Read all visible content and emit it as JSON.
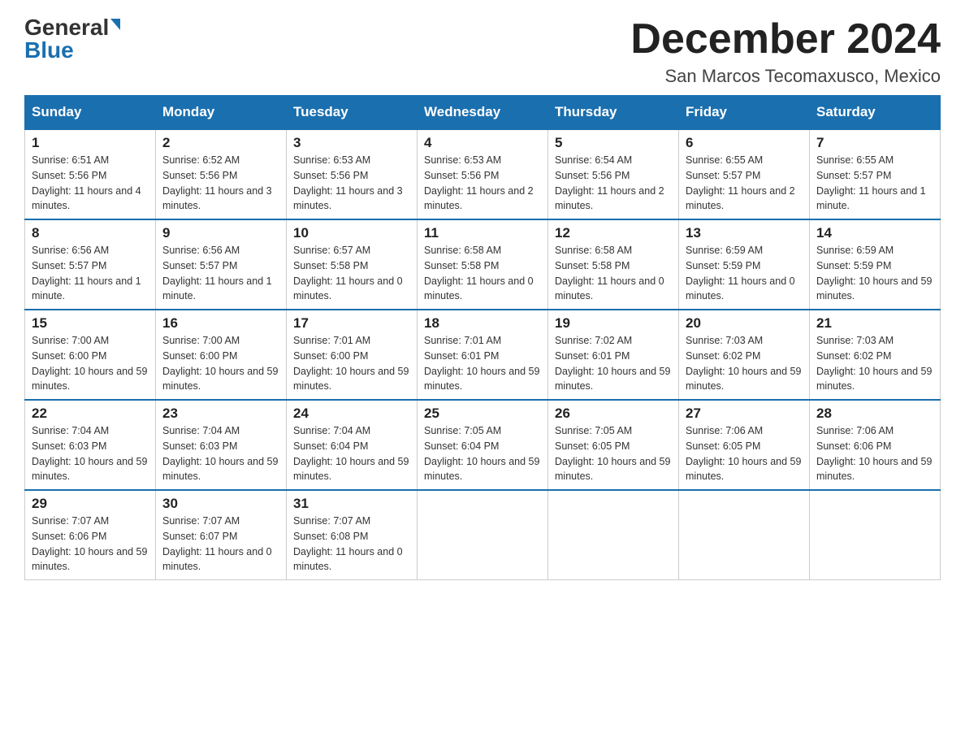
{
  "header": {
    "logo_general": "General",
    "logo_blue": "Blue",
    "title": "December 2024",
    "subtitle": "San Marcos Tecomaxusco, Mexico"
  },
  "days_of_week": [
    "Sunday",
    "Monday",
    "Tuesday",
    "Wednesday",
    "Thursday",
    "Friday",
    "Saturday"
  ],
  "weeks": [
    [
      {
        "day": "1",
        "sunrise": "6:51 AM",
        "sunset": "5:56 PM",
        "daylight": "11 hours and 4 minutes."
      },
      {
        "day": "2",
        "sunrise": "6:52 AM",
        "sunset": "5:56 PM",
        "daylight": "11 hours and 3 minutes."
      },
      {
        "day": "3",
        "sunrise": "6:53 AM",
        "sunset": "5:56 PM",
        "daylight": "11 hours and 3 minutes."
      },
      {
        "day": "4",
        "sunrise": "6:53 AM",
        "sunset": "5:56 PM",
        "daylight": "11 hours and 2 minutes."
      },
      {
        "day": "5",
        "sunrise": "6:54 AM",
        "sunset": "5:56 PM",
        "daylight": "11 hours and 2 minutes."
      },
      {
        "day": "6",
        "sunrise": "6:55 AM",
        "sunset": "5:57 PM",
        "daylight": "11 hours and 2 minutes."
      },
      {
        "day": "7",
        "sunrise": "6:55 AM",
        "sunset": "5:57 PM",
        "daylight": "11 hours and 1 minute."
      }
    ],
    [
      {
        "day": "8",
        "sunrise": "6:56 AM",
        "sunset": "5:57 PM",
        "daylight": "11 hours and 1 minute."
      },
      {
        "day": "9",
        "sunrise": "6:56 AM",
        "sunset": "5:57 PM",
        "daylight": "11 hours and 1 minute."
      },
      {
        "day": "10",
        "sunrise": "6:57 AM",
        "sunset": "5:58 PM",
        "daylight": "11 hours and 0 minutes."
      },
      {
        "day": "11",
        "sunrise": "6:58 AM",
        "sunset": "5:58 PM",
        "daylight": "11 hours and 0 minutes."
      },
      {
        "day": "12",
        "sunrise": "6:58 AM",
        "sunset": "5:58 PM",
        "daylight": "11 hours and 0 minutes."
      },
      {
        "day": "13",
        "sunrise": "6:59 AM",
        "sunset": "5:59 PM",
        "daylight": "11 hours and 0 minutes."
      },
      {
        "day": "14",
        "sunrise": "6:59 AM",
        "sunset": "5:59 PM",
        "daylight": "10 hours and 59 minutes."
      }
    ],
    [
      {
        "day": "15",
        "sunrise": "7:00 AM",
        "sunset": "6:00 PM",
        "daylight": "10 hours and 59 minutes."
      },
      {
        "day": "16",
        "sunrise": "7:00 AM",
        "sunset": "6:00 PM",
        "daylight": "10 hours and 59 minutes."
      },
      {
        "day": "17",
        "sunrise": "7:01 AM",
        "sunset": "6:00 PM",
        "daylight": "10 hours and 59 minutes."
      },
      {
        "day": "18",
        "sunrise": "7:01 AM",
        "sunset": "6:01 PM",
        "daylight": "10 hours and 59 minutes."
      },
      {
        "day": "19",
        "sunrise": "7:02 AM",
        "sunset": "6:01 PM",
        "daylight": "10 hours and 59 minutes."
      },
      {
        "day": "20",
        "sunrise": "7:03 AM",
        "sunset": "6:02 PM",
        "daylight": "10 hours and 59 minutes."
      },
      {
        "day": "21",
        "sunrise": "7:03 AM",
        "sunset": "6:02 PM",
        "daylight": "10 hours and 59 minutes."
      }
    ],
    [
      {
        "day": "22",
        "sunrise": "7:04 AM",
        "sunset": "6:03 PM",
        "daylight": "10 hours and 59 minutes."
      },
      {
        "day": "23",
        "sunrise": "7:04 AM",
        "sunset": "6:03 PM",
        "daylight": "10 hours and 59 minutes."
      },
      {
        "day": "24",
        "sunrise": "7:04 AM",
        "sunset": "6:04 PM",
        "daylight": "10 hours and 59 minutes."
      },
      {
        "day": "25",
        "sunrise": "7:05 AM",
        "sunset": "6:04 PM",
        "daylight": "10 hours and 59 minutes."
      },
      {
        "day": "26",
        "sunrise": "7:05 AM",
        "sunset": "6:05 PM",
        "daylight": "10 hours and 59 minutes."
      },
      {
        "day": "27",
        "sunrise": "7:06 AM",
        "sunset": "6:05 PM",
        "daylight": "10 hours and 59 minutes."
      },
      {
        "day": "28",
        "sunrise": "7:06 AM",
        "sunset": "6:06 PM",
        "daylight": "10 hours and 59 minutes."
      }
    ],
    [
      {
        "day": "29",
        "sunrise": "7:07 AM",
        "sunset": "6:06 PM",
        "daylight": "10 hours and 59 minutes."
      },
      {
        "day": "30",
        "sunrise": "7:07 AM",
        "sunset": "6:07 PM",
        "daylight": "11 hours and 0 minutes."
      },
      {
        "day": "31",
        "sunrise": "7:07 AM",
        "sunset": "6:08 PM",
        "daylight": "11 hours and 0 minutes."
      },
      null,
      null,
      null,
      null
    ]
  ]
}
